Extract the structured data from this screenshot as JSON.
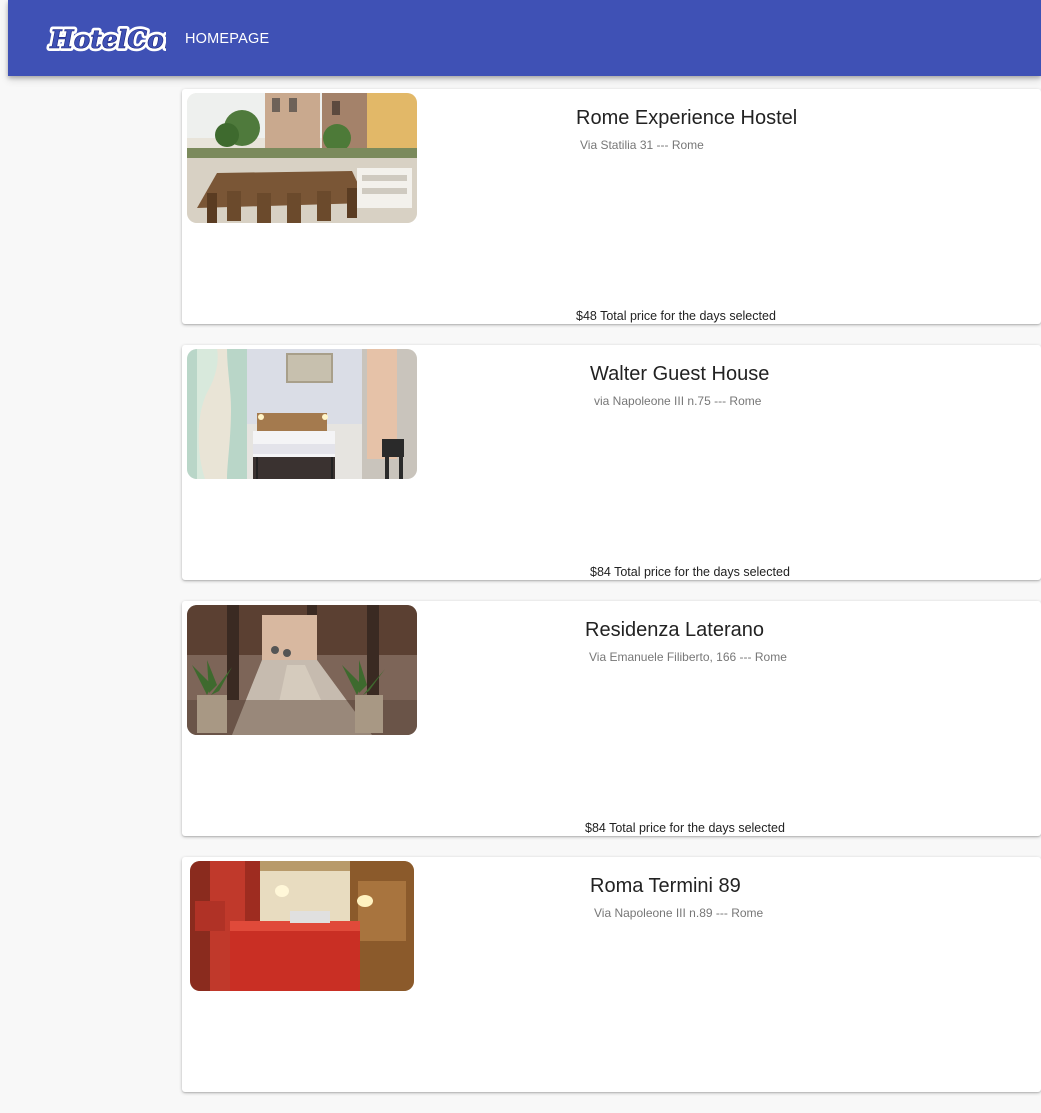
{
  "header": {
    "logo_text": "HotelCom",
    "nav_home": "HOMEPAGE",
    "color": "#3f51b5"
  },
  "hotels": [
    {
      "name": "Rome Experience Hostel",
      "address": "Via Statilia 31 --- Rome",
      "price": "$48 Total price for the days selected",
      "photo": "terrace-photo"
    },
    {
      "name": "Walter Guest House",
      "address": "via Napoleone III n.75 --- Rome",
      "price": "$84 Total price for the days selected",
      "photo": "bedroom-photo"
    },
    {
      "name": "Residenza Laterano",
      "address": "Via Emanuele Filiberto, 166 --- Rome",
      "price": "$84 Total price for the days selected",
      "photo": "entrance-photo"
    },
    {
      "name": "Roma Termini 89",
      "address": "Via Napoleone III n.89 --- Rome",
      "price": "",
      "photo": "red-room-photo"
    }
  ]
}
